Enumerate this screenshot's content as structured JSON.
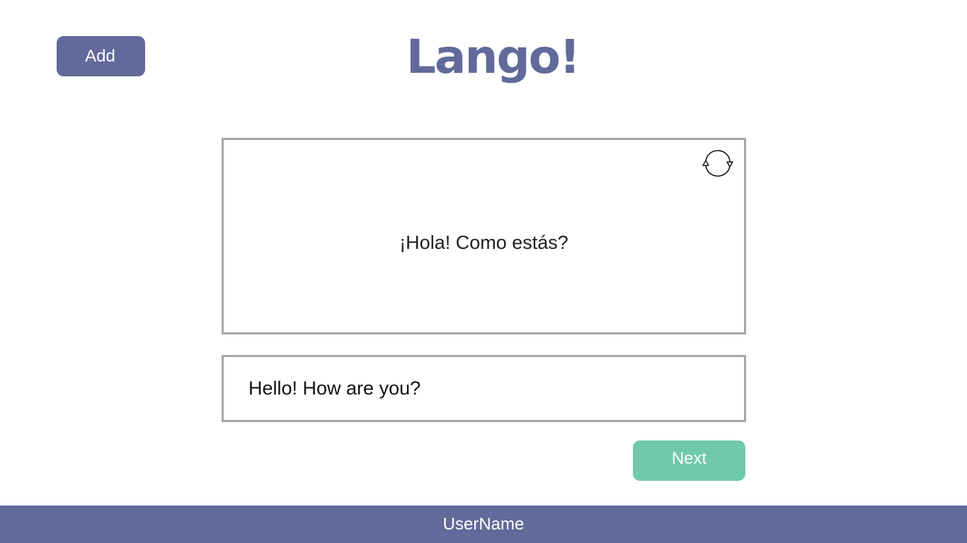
{
  "header": {
    "add_label": "Add",
    "title": "Lango!"
  },
  "card": {
    "text": "¡Hola! Como estás?",
    "flip_icon": "refresh-cycle-icon"
  },
  "answer": {
    "value": "Hello! How are you?"
  },
  "actions": {
    "next_label": "Next"
  },
  "footer": {
    "username": "UserName"
  },
  "colors": {
    "primary": "#616a9a",
    "accent": "#70c9ab",
    "border": "#a6a6a6",
    "background": "#ffffff"
  }
}
